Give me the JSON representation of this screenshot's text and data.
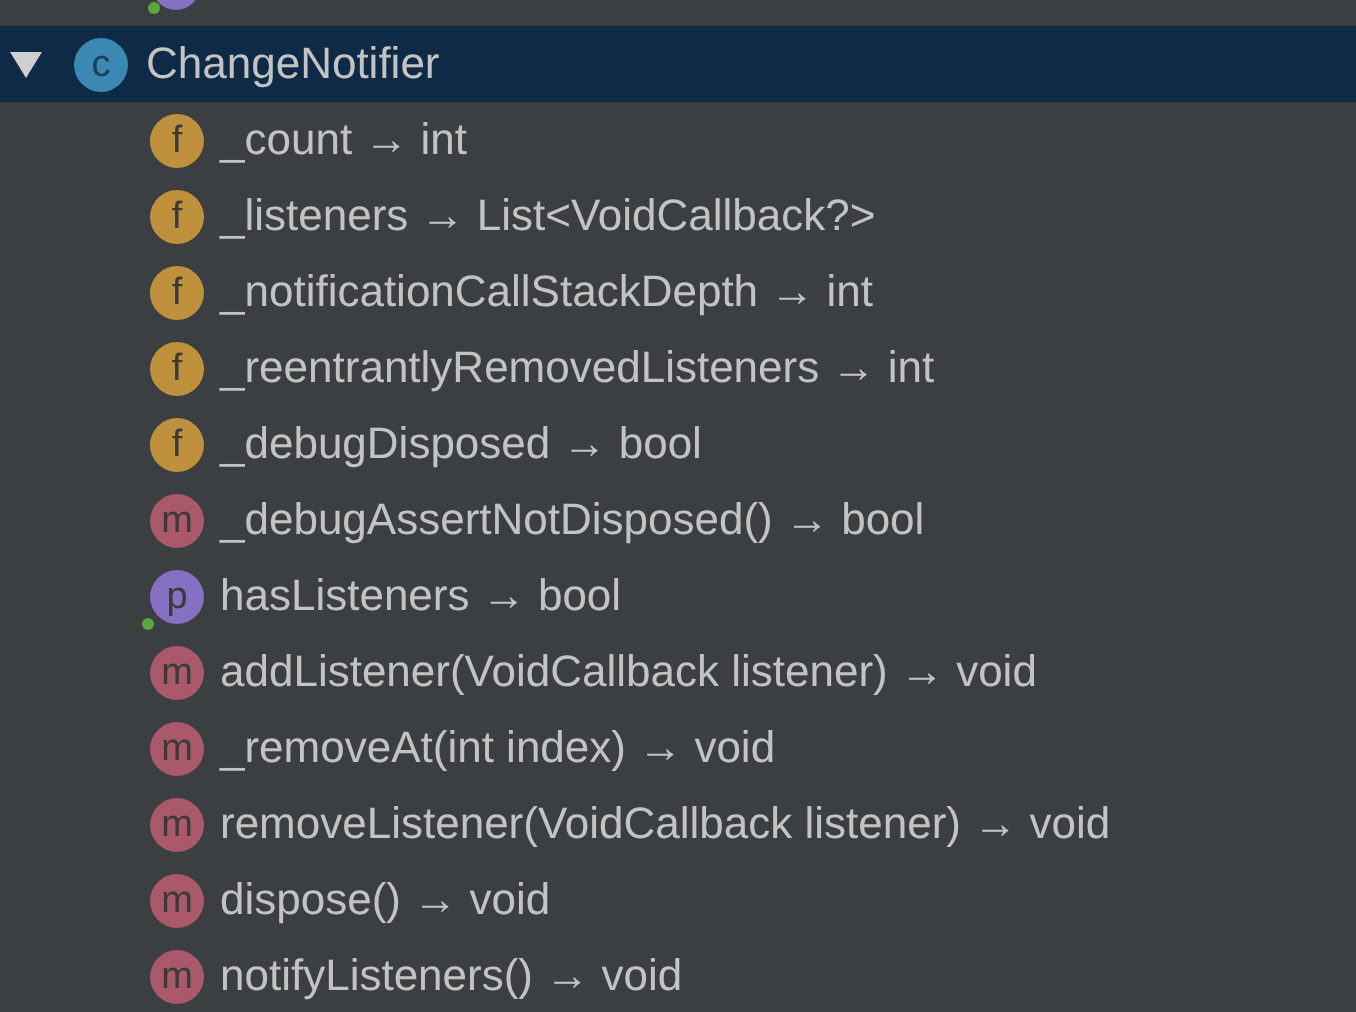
{
  "partial_item": {
    "kind": "p",
    "public": true
  },
  "tree": {
    "label": "ChangeNotifier",
    "kind": "c",
    "expanded": true,
    "selected": true,
    "children": [
      {
        "kind": "f",
        "label": "_count → int",
        "public": false
      },
      {
        "kind": "f",
        "label": "_listeners → List<VoidCallback?>",
        "public": false
      },
      {
        "kind": "f",
        "label": "_notificationCallStackDepth → int",
        "public": false
      },
      {
        "kind": "f",
        "label": "_reentrantlyRemovedListeners → int",
        "public": false
      },
      {
        "kind": "f",
        "label": "_debugDisposed → bool",
        "public": false
      },
      {
        "kind": "m",
        "label": "_debugAssertNotDisposed() → bool",
        "public": false
      },
      {
        "kind": "p",
        "label": "hasListeners → bool",
        "public": true
      },
      {
        "kind": "m",
        "label": "addListener(VoidCallback listener) → void",
        "public": false
      },
      {
        "kind": "m",
        "label": "_removeAt(int index) → void",
        "public": false
      },
      {
        "kind": "m",
        "label": "removeListener(VoidCallback listener) → void",
        "public": false
      },
      {
        "kind": "m",
        "label": "dispose() → void",
        "public": false
      },
      {
        "kind": "m",
        "label": "notifyListeners() → void",
        "public": false
      }
    ]
  }
}
